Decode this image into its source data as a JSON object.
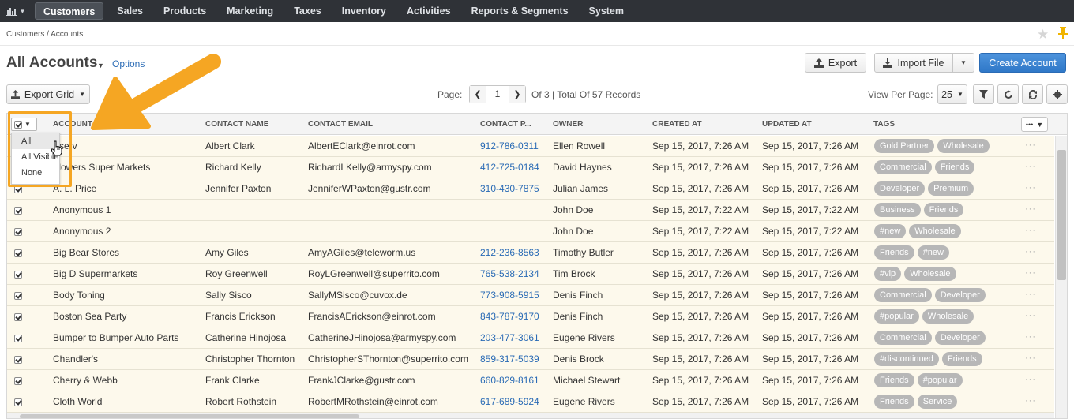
{
  "nav": {
    "items": [
      "Customers",
      "Sales",
      "Products",
      "Marketing",
      "Taxes",
      "Inventory",
      "Activities",
      "Reports & Segments",
      "System"
    ],
    "active": "Customers"
  },
  "breadcrumb": "Customers / Accounts",
  "page": {
    "title": "All Accounts",
    "options_label": "Options",
    "export_label": "Export",
    "import_label": "Import File",
    "create_label": "Create Account",
    "export_grid_label": "Export Grid"
  },
  "pager": {
    "label": "Page:",
    "current": "1",
    "total_text": "Of 3 | Total Of 57 Records",
    "view_per_page_label": "View Per Page:",
    "view_per_page_value": "25"
  },
  "columns": [
    "Account Name",
    "Contact Name",
    "Contact Email",
    "Contact P...",
    "Owner",
    "Created At",
    "Updated At",
    "Tags"
  ],
  "select_menu": {
    "options": [
      "All",
      "All Visible",
      "None"
    ]
  },
  "rows": [
    {
      "account": "Aserv",
      "contact": "Albert Clark",
      "email": "AlbertEClark@einrot.com",
      "phone": "912-786-0311",
      "owner": "Ellen Rowell",
      "created": "Sep 15, 2017, 7:26 AM",
      "updated": "Sep 15, 2017, 7:26 AM",
      "tags": [
        "Gold Partner",
        "Wholesale"
      ]
    },
    {
      "account": "Flowers Super Markets",
      "contact": "Richard Kelly",
      "email": "RichardLKelly@armyspy.com",
      "phone": "412-725-0184",
      "owner": "David Haynes",
      "created": "Sep 15, 2017, 7:26 AM",
      "updated": "Sep 15, 2017, 7:26 AM",
      "tags": [
        "Commercial",
        "Friends"
      ]
    },
    {
      "account": "A. L. Price",
      "contact": "Jennifer Paxton",
      "email": "JenniferWPaxton@gustr.com",
      "phone": "310-430-7875",
      "owner": "Julian James",
      "created": "Sep 15, 2017, 7:26 AM",
      "updated": "Sep 15, 2017, 7:26 AM",
      "tags": [
        "Developer",
        "Premium"
      ]
    },
    {
      "account": "Anonymous 1",
      "contact": "",
      "email": "",
      "phone": "",
      "owner": "John Doe",
      "created": "Sep 15, 2017, 7:22 AM",
      "updated": "Sep 15, 2017, 7:22 AM",
      "tags": [
        "Business",
        "Friends"
      ]
    },
    {
      "account": "Anonymous 2",
      "contact": "",
      "email": "",
      "phone": "",
      "owner": "John Doe",
      "created": "Sep 15, 2017, 7:22 AM",
      "updated": "Sep 15, 2017, 7:22 AM",
      "tags": [
        "#new",
        "Wholesale"
      ]
    },
    {
      "account": "Big Bear Stores",
      "contact": "Amy Giles",
      "email": "AmyAGiles@teleworm.us",
      "phone": "212-236-8563",
      "owner": "Timothy Butler",
      "created": "Sep 15, 2017, 7:26 AM",
      "updated": "Sep 15, 2017, 7:26 AM",
      "tags": [
        "Friends",
        "#new"
      ]
    },
    {
      "account": "Big D Supermarkets",
      "contact": "Roy Greenwell",
      "email": "RoyLGreenwell@superrito.com",
      "phone": "765-538-2134",
      "owner": "Tim Brock",
      "created": "Sep 15, 2017, 7:26 AM",
      "updated": "Sep 15, 2017, 7:26 AM",
      "tags": [
        "#vip",
        "Wholesale"
      ]
    },
    {
      "account": "Body Toning",
      "contact": "Sally Sisco",
      "email": "SallyMSisco@cuvox.de",
      "phone": "773-908-5915",
      "owner": "Denis Finch",
      "created": "Sep 15, 2017, 7:26 AM",
      "updated": "Sep 15, 2017, 7:26 AM",
      "tags": [
        "Commercial",
        "Developer"
      ]
    },
    {
      "account": "Boston Sea Party",
      "contact": "Francis Erickson",
      "email": "FrancisAErickson@einrot.com",
      "phone": "843-787-9170",
      "owner": "Denis Finch",
      "created": "Sep 15, 2017, 7:26 AM",
      "updated": "Sep 15, 2017, 7:26 AM",
      "tags": [
        "#popular",
        "Wholesale"
      ]
    },
    {
      "account": "Bumper to Bumper Auto Parts",
      "contact": "Catherine Hinojosa",
      "email": "CatherineJHinojosa@armyspy.com",
      "phone": "203-477-3061",
      "owner": "Eugene Rivers",
      "created": "Sep 15, 2017, 7:26 AM",
      "updated": "Sep 15, 2017, 7:26 AM",
      "tags": [
        "Commercial",
        "Developer"
      ]
    },
    {
      "account": "Chandler's",
      "contact": "Christopher Thornton",
      "email": "ChristopherSThornton@superrito.com",
      "phone": "859-317-5039",
      "owner": "Denis Brock",
      "created": "Sep 15, 2017, 7:26 AM",
      "updated": "Sep 15, 2017, 7:26 AM",
      "tags": [
        "#discontinued",
        "Friends"
      ]
    },
    {
      "account": "Cherry & Webb",
      "contact": "Frank Clarke",
      "email": "FrankJClarke@gustr.com",
      "phone": "660-829-8161",
      "owner": "Michael Stewart",
      "created": "Sep 15, 2017, 7:26 AM",
      "updated": "Sep 15, 2017, 7:26 AM",
      "tags": [
        "Friends",
        "#popular"
      ]
    },
    {
      "account": "Cloth World",
      "contact": "Robert Rothstein",
      "email": "RobertMRothstein@einrot.com",
      "phone": "617-689-5924",
      "owner": "Eugene Rivers",
      "created": "Sep 15, 2017, 7:26 AM",
      "updated": "Sep 15, 2017, 7:26 AM",
      "tags": [
        "Friends",
        "Service"
      ]
    }
  ],
  "colors": {
    "topnav": "#2f3237",
    "primary": "#2f78c8",
    "link": "#2a6bb5",
    "row_bg": "#fdf9ec",
    "tag": "#b7b7b7",
    "highlight": "#f5a623"
  },
  "icons": {
    "logo": "bar-chart-icon",
    "star": "star-icon",
    "pin": "pin-icon",
    "export": "upload-icon",
    "import": "download-icon",
    "filter": "filter-icon",
    "refresh": "refresh-icon",
    "sync": "sync-icon",
    "settings": "gear-icon"
  }
}
